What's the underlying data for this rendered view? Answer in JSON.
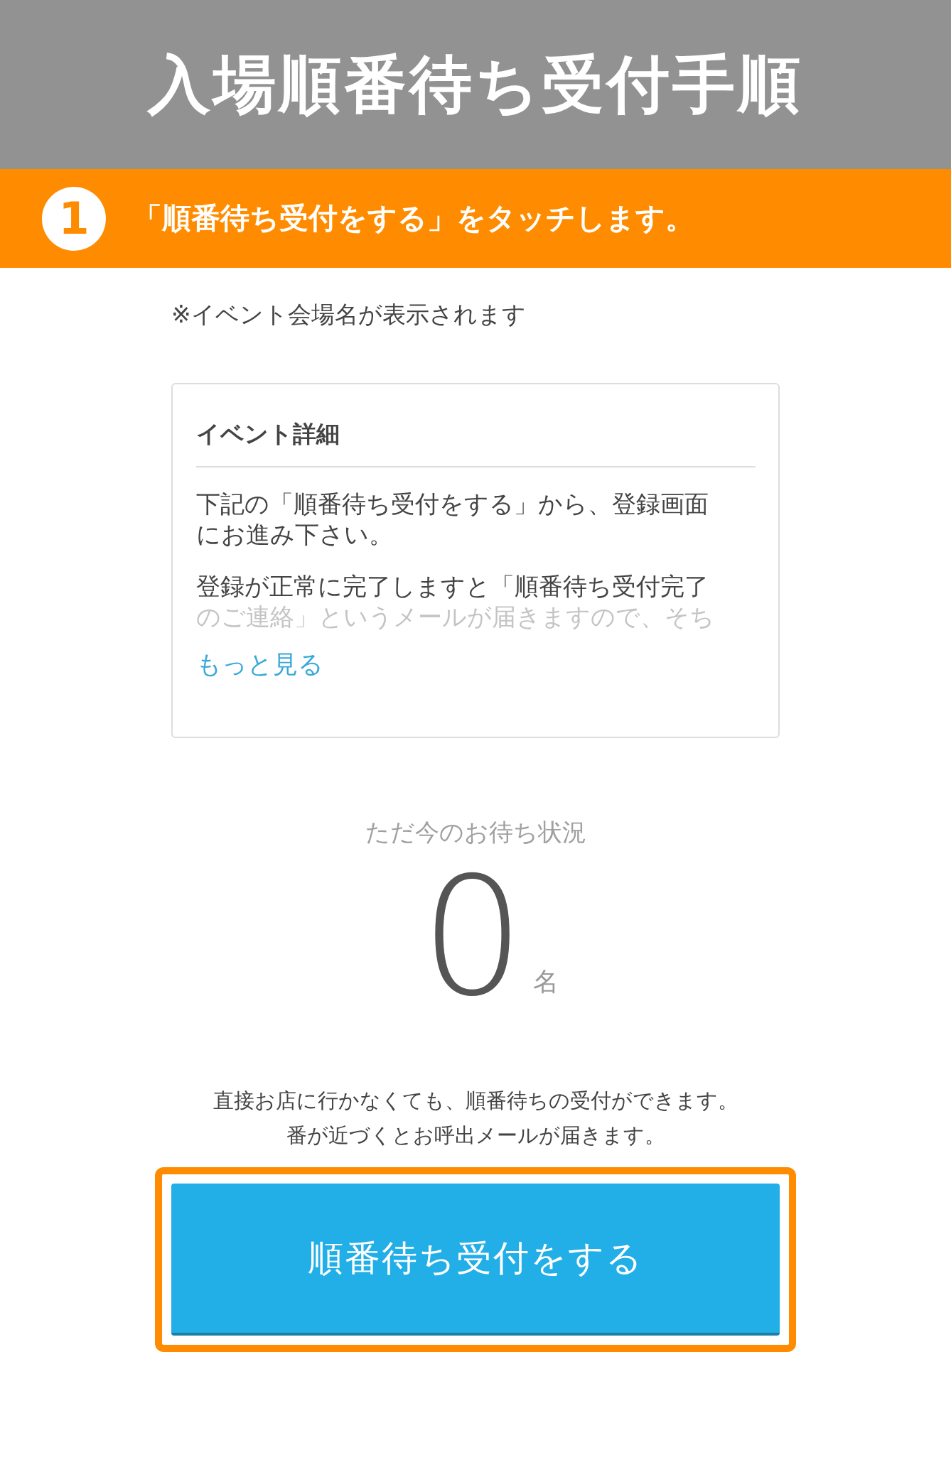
{
  "header": {
    "title": "入場順番待ち受付手順"
  },
  "step": {
    "number": "1",
    "text": "「順番待ち受付をする」をタッチします。"
  },
  "note": "※イベント会場名が表示されます",
  "event_card": {
    "title": "イベント詳細",
    "paragraphs": [
      {
        "lines": [
          {
            "text": "下記の「順番待ち受付をする」から、登録画面",
            "faded": false
          },
          {
            "text": "にお進み下さい。",
            "faded": false
          }
        ]
      },
      {
        "lines": [
          {
            "text": "登録が正常に完了しますと「順番待ち受付完了",
            "faded": false
          },
          {
            "text": "のご連絡」というメールが届きますので、そち",
            "faded": true
          }
        ]
      }
    ],
    "more_link": "もっと見る"
  },
  "waiting": {
    "label": "ただ今のお待ち状況",
    "count": "0",
    "unit": "名"
  },
  "description": [
    "直接お店に行かなくても、順番待ちの受付ができます。",
    "番が近づくとお呼出メールが届きます。"
  ],
  "action_button": {
    "label": "順番待ち受付をする",
    "highlighted": true
  }
}
